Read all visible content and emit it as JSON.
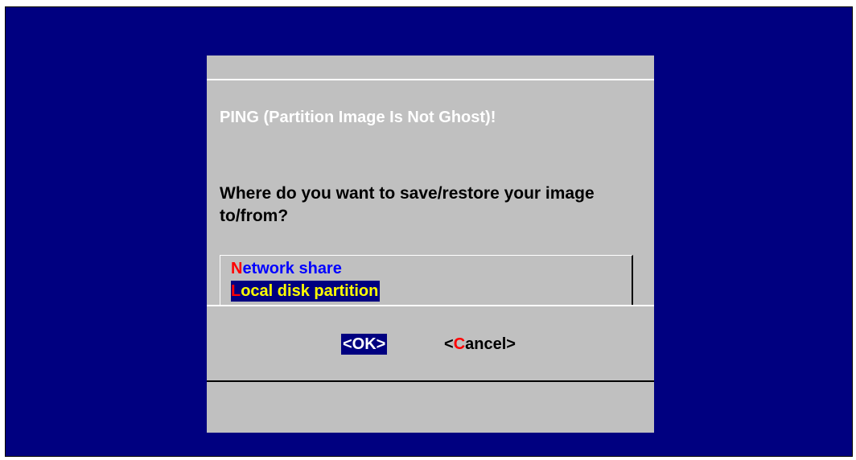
{
  "dialog": {
    "title": "PING (Partition Image Is Not Ghost)!",
    "question": "Where do you want to save/restore your image to/from?",
    "menu": {
      "items": [
        {
          "hotkey": "N",
          "rest": "etwork share",
          "selected": false
        },
        {
          "hotkey": "L",
          "rest": "ocal disk partition",
          "selected": true
        }
      ]
    },
    "buttons": {
      "ok": {
        "label": "<OK>"
      },
      "cancel": {
        "prefix": "<",
        "hotkey": "C",
        "rest": "ancel>"
      }
    }
  },
  "colors": {
    "background": "#000080",
    "dialog": "#c0c0c0",
    "title_text": "#ffffff",
    "hotkey": "#ff0000",
    "menu_item": "#0000ff",
    "selected_bg": "#000080",
    "selected_text": "#ffff00"
  }
}
